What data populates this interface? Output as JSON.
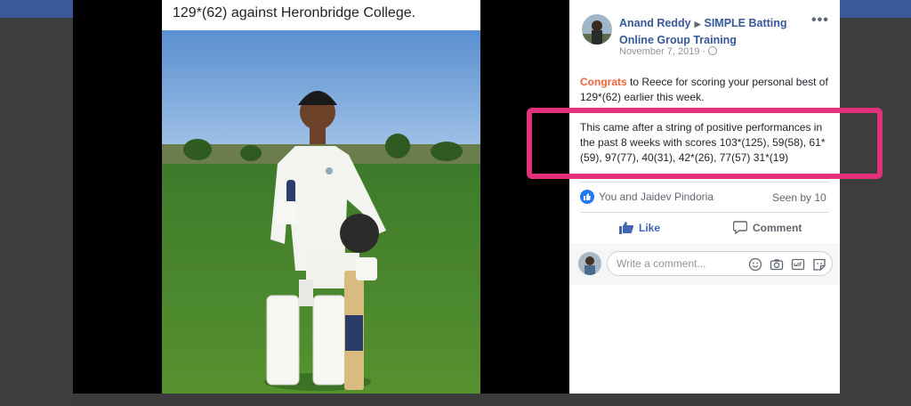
{
  "photo": {
    "caption": "129*(62) against Heronbridge College."
  },
  "post": {
    "author": "Anand Reddy",
    "group": "SIMPLE Batting Online Group Training",
    "date": "November 7, 2019 ·",
    "congrats": "Congrats",
    "paragraph1_rest": " to Reece for scoring your personal best of 129*(62) earlier this week.",
    "paragraph2": "This came after a string of positive performances in the past 8 weeks with scores 103*(125), 59(58), 61*(59), 97(77), 40(31), 42*(26), 77(57) 31*(19)"
  },
  "reactions": {
    "text": "You and Jaidev Pindoria",
    "seen": "Seen by 10"
  },
  "actions": {
    "like": "Like",
    "comment": "Comment"
  },
  "composer": {
    "placeholder": "Write a comment..."
  },
  "colors": {
    "brand": "#4267b2",
    "highlight": "#e0317a",
    "congrats": "#f0643c"
  }
}
